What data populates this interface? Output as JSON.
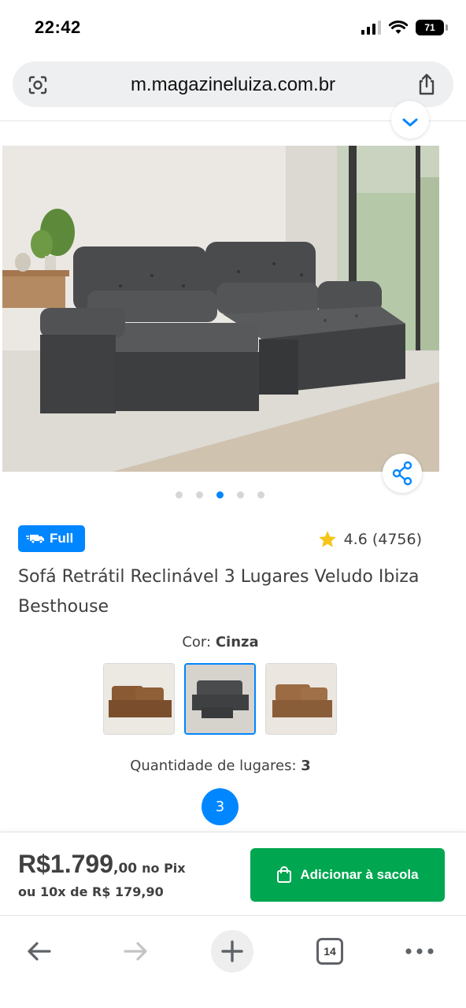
{
  "status_bar": {
    "time": "22:42",
    "battery": "71",
    "icons": [
      "signal-icon",
      "wifi-icon",
      "battery-icon"
    ]
  },
  "browser": {
    "url": "m.magazineluiza.com.br",
    "left_icon": "lens-icon",
    "right_icon": "share-icon"
  },
  "product": {
    "image_dots": 5,
    "active_dot": 3,
    "badge": "Full",
    "rating": "4.6 (4756)",
    "title": "Sofá Retrátil Reclinável 3 Lugares Veludo Ibiza Besthouse",
    "color_label": "Cor:",
    "color_value": "Cinza",
    "color_swatches": [
      "Marrom",
      "Cinza",
      "Caramelo"
    ],
    "selected_swatch": 1,
    "seats_label": "Quantidade de lugares:",
    "seats_value": "3",
    "seat_option": "3"
  },
  "purchase": {
    "price_main": "R$1.799",
    "price_cents": ",00",
    "price_method": "no Pix",
    "installments": "ou 10x de R$ 179,90",
    "add_button": "Adicionar à sacola"
  },
  "toolbar": {
    "tabs_count": "14",
    "icons": [
      "back-arrow-icon",
      "forward-arrow-icon",
      "plus-icon",
      "tabs-icon",
      "more-icon"
    ]
  },
  "colors": {
    "brand_blue": "#0086ff",
    "cta_green": "#00a650",
    "text": "#404040",
    "star": "#f5c518"
  }
}
